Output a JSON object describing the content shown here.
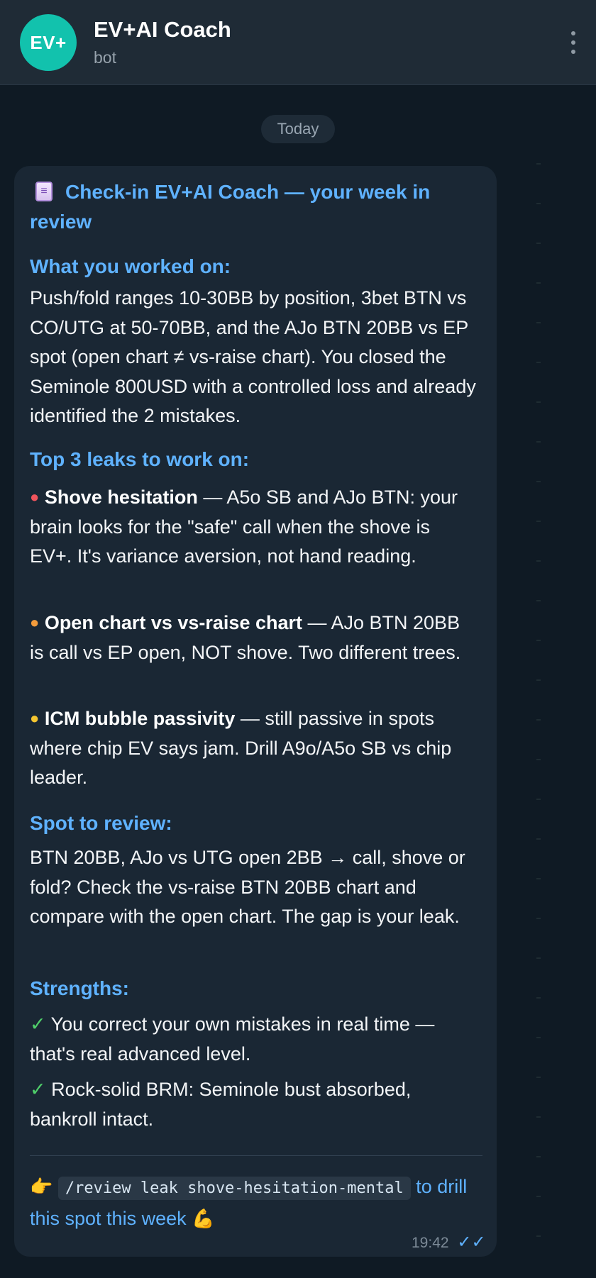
{
  "header": {
    "avatar_text": "EV+",
    "title": "EV+AI Coach",
    "subtitle": "bot",
    "menu_icon": "vertical-dots-icon"
  },
  "date_separator": "Today",
  "message": {
    "title_icon": "card-index-emoji",
    "title": "Check-in EV+AI Coach — your week in review",
    "worked_on": {
      "heading": "What you worked on:",
      "body": "Push/fold ranges 10-30BB by position, 3bet BTN vs CO/UTG at 50-70BB, and the AJo BTN 20BB vs EP spot (open chart ≠ vs-raise chart). You closed the Seminole 800USD with a controlled loss and already identified the 2 mistakes."
    },
    "leaks": {
      "heading": "Top 3 leaks to work on:",
      "items": [
        {
          "bullet": "●",
          "bullet_color": "#f0545c",
          "title": "Shove hesitation",
          "text": " — A5o SB and AJo BTN: your brain looks for the \"safe\" call when the shove is EV+. It's variance aversion, not hand reading."
        },
        {
          "bullet": "●",
          "bullet_color": "#f39c3c",
          "title": "Open chart vs vs-raise chart",
          "text": " — AJo BTN 20BB is call vs EP open, NOT shove. Two different trees."
        },
        {
          "bullet": "●",
          "bullet_color": "#f4c530",
          "title": "ICM bubble passivity",
          "text": " — still passive in spots where chip EV says jam. Drill A9o/A5o SB vs chip leader."
        }
      ]
    },
    "spot": {
      "heading": "Spot to review:",
      "body": "BTN 20BB, AJo vs UTG open 2BB → call, shove or fold? Check the vs-raise BTN 20BB chart and compare with the open chart. The gap is your leak."
    },
    "strengths": {
      "heading": "Strengths:",
      "items": [
        {
          "mark": "✓",
          "text": " You correct your own mistakes in real time — that's real advanced level."
        },
        {
          "mark": "✓",
          "text": " Rock-solid BRM: Seminole bust absorbed, bankroll intact."
        }
      ]
    },
    "cta": {
      "lead_emoji": "👉",
      "command": "/review leak shove-hesitation-mental",
      "text": " to drill this spot this week ",
      "trail_emoji": "💪"
    },
    "time": "19:42",
    "status": "✓✓"
  }
}
